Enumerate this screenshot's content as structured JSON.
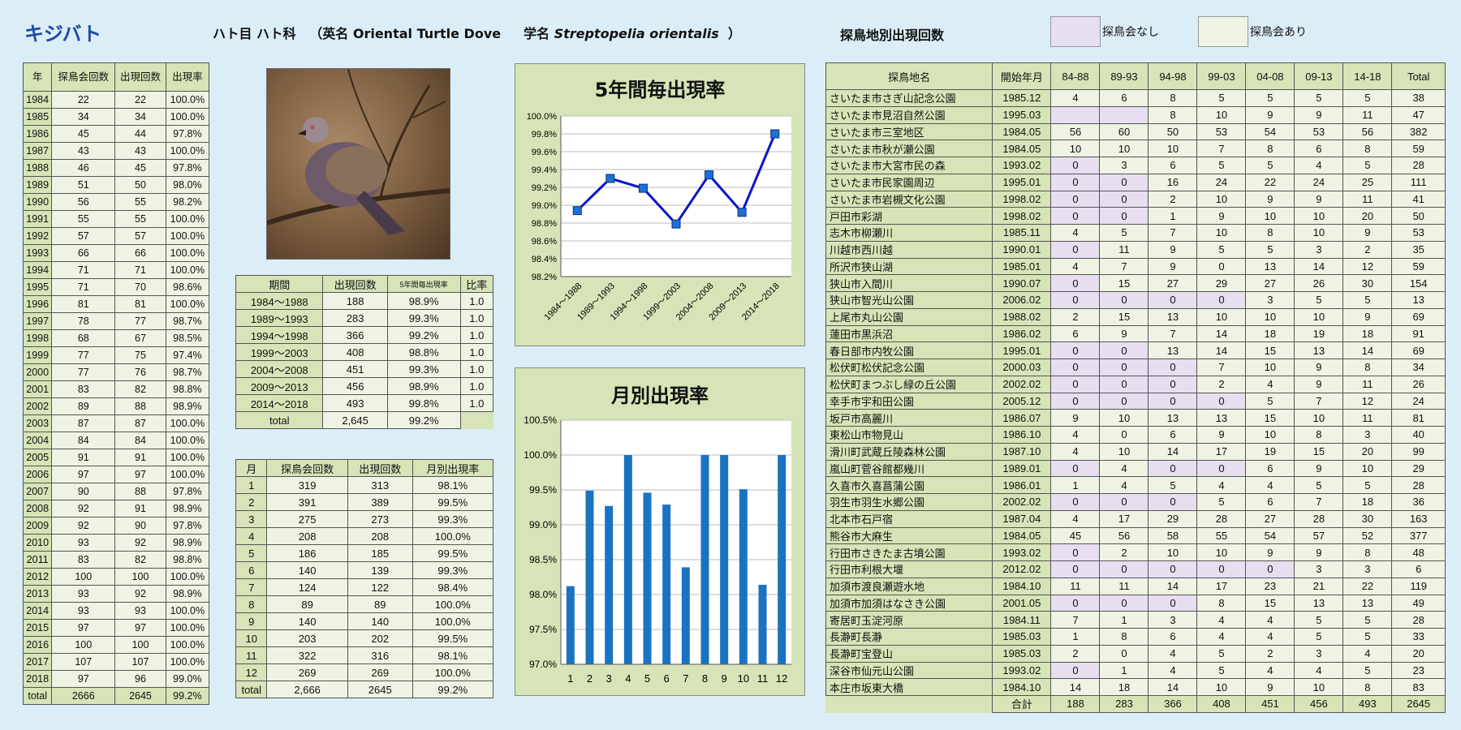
{
  "header": {
    "name_jp": "キジバト",
    "order_family": "ハト目 ハト科",
    "en_prefix": "（英名",
    "en_name": "Oriental Turtle Dove",
    "sci_prefix": "学名",
    "sci_name": "Streptopelia orientalis",
    "close": "）",
    "loc_title": "探鳥地別出現回数",
    "legend_none": "探鳥会なし",
    "legend_exist": "探鳥会あり"
  },
  "colors": {
    "bg": "#dbeef7",
    "header_cell": "#d7e4b7",
    "data_cell": "#eef3e3",
    "no_event_cell": "#e7def0",
    "title_blue": "#1f4aa8",
    "line_color": "#0a14c8",
    "bar_color": "#1a73c1"
  },
  "year_table": {
    "headers": [
      "年",
      "探鳥会回数",
      "出現回数",
      "出現率"
    ],
    "rows": [
      [
        "1984",
        "22",
        "22",
        "100.0%"
      ],
      [
        "1985",
        "34",
        "34",
        "100.0%"
      ],
      [
        "1986",
        "45",
        "44",
        "97.8%"
      ],
      [
        "1987",
        "43",
        "43",
        "100.0%"
      ],
      [
        "1988",
        "46",
        "45",
        "97.8%"
      ],
      [
        "1989",
        "51",
        "50",
        "98.0%"
      ],
      [
        "1990",
        "56",
        "55",
        "98.2%"
      ],
      [
        "1991",
        "55",
        "55",
        "100.0%"
      ],
      [
        "1992",
        "57",
        "57",
        "100.0%"
      ],
      [
        "1993",
        "66",
        "66",
        "100.0%"
      ],
      [
        "1994",
        "71",
        "71",
        "100.0%"
      ],
      [
        "1995",
        "71",
        "70",
        "98.6%"
      ],
      [
        "1996",
        "81",
        "81",
        "100.0%"
      ],
      [
        "1997",
        "78",
        "77",
        "98.7%"
      ],
      [
        "1998",
        "68",
        "67",
        "98.5%"
      ],
      [
        "1999",
        "77",
        "75",
        "97.4%"
      ],
      [
        "2000",
        "77",
        "76",
        "98.7%"
      ],
      [
        "2001",
        "83",
        "82",
        "98.8%"
      ],
      [
        "2002",
        "89",
        "88",
        "98.9%"
      ],
      [
        "2003",
        "87",
        "87",
        "100.0%"
      ],
      [
        "2004",
        "84",
        "84",
        "100.0%"
      ],
      [
        "2005",
        "91",
        "91",
        "100.0%"
      ],
      [
        "2006",
        "97",
        "97",
        "100.0%"
      ],
      [
        "2007",
        "90",
        "88",
        "97.8%"
      ],
      [
        "2008",
        "92",
        "91",
        "98.9%"
      ],
      [
        "2009",
        "92",
        "90",
        "97.8%"
      ],
      [
        "2010",
        "93",
        "92",
        "98.9%"
      ],
      [
        "2011",
        "83",
        "82",
        "98.8%"
      ],
      [
        "2012",
        "100",
        "100",
        "100.0%"
      ],
      [
        "2013",
        "93",
        "92",
        "98.9%"
      ],
      [
        "2014",
        "93",
        "93",
        "100.0%"
      ],
      [
        "2015",
        "97",
        "97",
        "100.0%"
      ],
      [
        "2016",
        "100",
        "100",
        "100.0%"
      ],
      [
        "2017",
        "107",
        "107",
        "100.0%"
      ],
      [
        "2018",
        "97",
        "96",
        "99.0%"
      ]
    ],
    "total": [
      "total",
      "2666",
      "2645",
      "99.2%"
    ]
  },
  "period_table": {
    "headers": [
      "期間",
      "出現回数",
      "5年間毎出現率",
      "比率"
    ],
    "rows": [
      [
        "1984～1988",
        "188",
        "98.9%",
        "1.0"
      ],
      [
        "1989～1993",
        "283",
        "99.3%",
        "1.0"
      ],
      [
        "1994～1998",
        "366",
        "99.2%",
        "1.0"
      ],
      [
        "1999～2003",
        "408",
        "98.8%",
        "1.0"
      ],
      [
        "2004～2008",
        "451",
        "99.3%",
        "1.0"
      ],
      [
        "2009～2013",
        "456",
        "98.9%",
        "1.0"
      ],
      [
        "2014～2018",
        "493",
        "99.8%",
        "1.0"
      ]
    ],
    "total": [
      "total",
      "2,645",
      "99.2%"
    ]
  },
  "month_table": {
    "headers": [
      "月",
      "探鳥会回数",
      "出現回数",
      "月別出現率"
    ],
    "rows": [
      [
        "1",
        "319",
        "313",
        "98.1%"
      ],
      [
        "2",
        "391",
        "389",
        "99.5%"
      ],
      [
        "3",
        "275",
        "273",
        "99.3%"
      ],
      [
        "4",
        "208",
        "208",
        "100.0%"
      ],
      [
        "5",
        "186",
        "185",
        "99.5%"
      ],
      [
        "6",
        "140",
        "139",
        "99.3%"
      ],
      [
        "7",
        "124",
        "122",
        "98.4%"
      ],
      [
        "8",
        "89",
        "89",
        "100.0%"
      ],
      [
        "9",
        "140",
        "140",
        "100.0%"
      ],
      [
        "10",
        "203",
        "202",
        "99.5%"
      ],
      [
        "11",
        "322",
        "316",
        "98.1%"
      ],
      [
        "12",
        "269",
        "269",
        "100.0%"
      ]
    ],
    "total": [
      "total",
      "2,666",
      "2645",
      "99.2%"
    ]
  },
  "loc_table": {
    "headers": [
      "探鳥地名",
      "開始年月",
      "84-88",
      "89-93",
      "94-98",
      "99-03",
      "04-08",
      "09-13",
      "14-18",
      "Total"
    ],
    "rows": [
      {
        "name": "さいたま市さぎ山記念公園",
        "start": "1985.12",
        "vals": [
          "4",
          "6",
          "8",
          "5",
          "5",
          "5",
          "5"
        ],
        "na": [],
        "total": "38"
      },
      {
        "name": "さいたま市見沼自然公園",
        "start": "1995.03",
        "vals": [
          "",
          "",
          "8",
          "10",
          "9",
          "9",
          "11"
        ],
        "na": [
          0,
          1
        ],
        "total": "47"
      },
      {
        "name": "さいたま市三室地区",
        "start": "1984.05",
        "vals": [
          "56",
          "60",
          "50",
          "53",
          "54",
          "53",
          "56"
        ],
        "na": [],
        "total": "382"
      },
      {
        "name": "さいたま市秋が瀬公園",
        "start": "1984.05",
        "vals": [
          "10",
          "10",
          "10",
          "7",
          "8",
          "6",
          "8"
        ],
        "na": [],
        "total": "59"
      },
      {
        "name": "さいたま市大宮市民の森",
        "start": "1993.02",
        "vals": [
          "0",
          "3",
          "6",
          "5",
          "5",
          "4",
          "5"
        ],
        "na": [
          0
        ],
        "total": "28"
      },
      {
        "name": "さいたま市民家園周辺",
        "start": "1995.01",
        "vals": [
          "0",
          "0",
          "16",
          "24",
          "22",
          "24",
          "25"
        ],
        "na": [
          0,
          1
        ],
        "total": "111"
      },
      {
        "name": "さいたま市岩槻文化公園",
        "start": "1998.02",
        "vals": [
          "0",
          "0",
          "2",
          "10",
          "9",
          "9",
          "11"
        ],
        "na": [
          0,
          1
        ],
        "total": "41"
      },
      {
        "name": "戸田市彩湖",
        "start": "1998.02",
        "vals": [
          "0",
          "0",
          "1",
          "9",
          "10",
          "10",
          "20"
        ],
        "na": [
          0,
          1
        ],
        "total": "50"
      },
      {
        "name": "志木市柳瀬川",
        "start": "1985.11",
        "vals": [
          "4",
          "5",
          "7",
          "10",
          "8",
          "10",
          "9"
        ],
        "na": [],
        "total": "53"
      },
      {
        "name": "川越市西川越",
        "start": "1990.01",
        "vals": [
          "0",
          "11",
          "9",
          "5",
          "5",
          "3",
          "2"
        ],
        "na": [
          0
        ],
        "total": "35"
      },
      {
        "name": "所沢市狭山湖",
        "start": "1985.01",
        "vals": [
          "4",
          "7",
          "9",
          "0",
          "13",
          "14",
          "12"
        ],
        "na": [],
        "total": "59"
      },
      {
        "name": "狭山市入間川",
        "start": "1990.07",
        "vals": [
          "0",
          "15",
          "27",
          "29",
          "27",
          "26",
          "30"
        ],
        "na": [
          0
        ],
        "total": "154"
      },
      {
        "name": "狭山市智光山公園",
        "start": "2006.02",
        "vals": [
          "0",
          "0",
          "0",
          "0",
          "3",
          "5",
          "5"
        ],
        "na": [
          0,
          1,
          2,
          3
        ],
        "total": "13"
      },
      {
        "name": "上尾市丸山公園",
        "start": "1988.02",
        "vals": [
          "2",
          "15",
          "13",
          "10",
          "10",
          "10",
          "9"
        ],
        "na": [],
        "total": "69"
      },
      {
        "name": "蓮田市黒浜沼",
        "start": "1986.02",
        "vals": [
          "6",
          "9",
          "7",
          "14",
          "18",
          "19",
          "18"
        ],
        "na": [],
        "total": "91"
      },
      {
        "name": "春日部市内牧公園",
        "start": "1995.01",
        "vals": [
          "0",
          "0",
          "13",
          "14",
          "15",
          "13",
          "14"
        ],
        "na": [
          0,
          1
        ],
        "total": "69"
      },
      {
        "name": "松伏町松伏記念公園",
        "start": "2000.03",
        "vals": [
          "0",
          "0",
          "0",
          "7",
          "10",
          "9",
          "8"
        ],
        "na": [
          0,
          1,
          2
        ],
        "total": "34"
      },
      {
        "name": "松伏町まつぶし緑の丘公園",
        "start": "2002.02",
        "vals": [
          "0",
          "0",
          "0",
          "2",
          "4",
          "9",
          "11"
        ],
        "na": [
          0,
          1,
          2
        ],
        "total": "26"
      },
      {
        "name": "幸手市宇和田公園",
        "start": "2005.12",
        "vals": [
          "0",
          "0",
          "0",
          "0",
          "5",
          "7",
          "12"
        ],
        "na": [
          0,
          1,
          2,
          3
        ],
        "total": "24"
      },
      {
        "name": "坂戸市高麗川",
        "start": "1986.07",
        "vals": [
          "9",
          "10",
          "13",
          "13",
          "15",
          "10",
          "11"
        ],
        "na": [],
        "total": "81"
      },
      {
        "name": "東松山市物見山",
        "start": "1986.10",
        "vals": [
          "4",
          "0",
          "6",
          "9",
          "10",
          "8",
          "3"
        ],
        "na": [],
        "total": "40"
      },
      {
        "name": "滑川町武蔵丘陵森林公園",
        "start": "1987.10",
        "vals": [
          "4",
          "10",
          "14",
          "17",
          "19",
          "15",
          "20"
        ],
        "na": [],
        "total": "99"
      },
      {
        "name": "嵐山町菅谷館都幾川",
        "start": "1989.01",
        "vals": [
          "0",
          "4",
          "0",
          "0",
          "6",
          "9",
          "10"
        ],
        "na": [
          0,
          2,
          3
        ],
        "total": "29"
      },
      {
        "name": "久喜市久喜菖蒲公園",
        "start": "1986.01",
        "vals": [
          "1",
          "4",
          "5",
          "4",
          "4",
          "5",
          "5"
        ],
        "na": [],
        "total": "28"
      },
      {
        "name": "羽生市羽生水郷公園",
        "start": "2002.02",
        "vals": [
          "0",
          "0",
          "0",
          "5",
          "6",
          "7",
          "18"
        ],
        "na": [
          0,
          1,
          2
        ],
        "total": "36"
      },
      {
        "name": "北本市石戸宿",
        "start": "1987.04",
        "vals": [
          "4",
          "17",
          "29",
          "28",
          "27",
          "28",
          "30"
        ],
        "na": [],
        "total": "163"
      },
      {
        "name": "熊谷市大麻生",
        "start": "1984.05",
        "vals": [
          "45",
          "56",
          "58",
          "55",
          "54",
          "57",
          "52"
        ],
        "na": [],
        "total": "377"
      },
      {
        "name": "行田市さきたま古墳公園",
        "start": "1993.02",
        "vals": [
          "0",
          "2",
          "10",
          "10",
          "9",
          "9",
          "8"
        ],
        "na": [
          0
        ],
        "total": "48"
      },
      {
        "name": "行田市利根大堰",
        "start": "2012.02",
        "vals": [
          "0",
          "0",
          "0",
          "0",
          "0",
          "3",
          "3"
        ],
        "na": [
          0,
          1,
          2,
          3,
          4
        ],
        "total": "6"
      },
      {
        "name": "加須市渡良瀬遊水地",
        "start": "1984.10",
        "vals": [
          "11",
          "11",
          "14",
          "17",
          "23",
          "21",
          "22"
        ],
        "na": [],
        "total": "119"
      },
      {
        "name": "加須市加須はなさき公園",
        "start": "2001.05",
        "vals": [
          "0",
          "0",
          "0",
          "8",
          "15",
          "13",
          "13"
        ],
        "na": [
          0,
          1,
          2
        ],
        "total": "49"
      },
      {
        "name": "寄居町玉淀河原",
        "start": "1984.11",
        "vals": [
          "7",
          "1",
          "3",
          "4",
          "4",
          "5",
          "5"
        ],
        "na": [],
        "total": "28"
      },
      {
        "name": "長瀞町長瀞",
        "start": "1985.03",
        "vals": [
          "1",
          "8",
          "6",
          "4",
          "4",
          "5",
          "5"
        ],
        "na": [],
        "total": "33"
      },
      {
        "name": "長瀞町宝登山",
        "start": "1985.03",
        "vals": [
          "2",
          "0",
          "4",
          "5",
          "2",
          "3",
          "4"
        ],
        "na": [],
        "total": "20"
      },
      {
        "name": "深谷市仙元山公園",
        "start": "1993.02",
        "vals": [
          "0",
          "1",
          "4",
          "5",
          "4",
          "4",
          "5"
        ],
        "na": [
          0
        ],
        "total": "23"
      },
      {
        "name": "本庄市坂東大橋",
        "start": "1984.10",
        "vals": [
          "14",
          "18",
          "14",
          "10",
          "9",
          "10",
          "8"
        ],
        "na": [],
        "total": "83"
      }
    ],
    "sum_label": "合計",
    "sums": [
      "188",
      "283",
      "366",
      "408",
      "451",
      "456",
      "493",
      "2645"
    ]
  },
  "chart_data": [
    {
      "type": "line",
      "title": "5年間毎出現率",
      "categories": [
        "1984～1988",
        "1989～1993",
        "1994～1998",
        "1999～2003",
        "2004～2008",
        "2009～2013",
        "2014～2018"
      ],
      "values": [
        98.94,
        99.3,
        99.19,
        98.79,
        99.34,
        98.92,
        99.8
      ],
      "ylim": [
        98.2,
        100.0
      ],
      "yticks": [
        "98.2%",
        "98.4%",
        "98.6%",
        "98.8%",
        "99.0%",
        "99.2%",
        "99.4%",
        "99.6%",
        "99.8%",
        "100.0%"
      ],
      "grid": true
    },
    {
      "type": "bar",
      "title": "月別出現率",
      "categories": [
        "1",
        "2",
        "3",
        "4",
        "5",
        "6",
        "7",
        "8",
        "9",
        "10",
        "11",
        "12"
      ],
      "values": [
        98.12,
        99.49,
        99.27,
        100.0,
        99.46,
        99.29,
        98.39,
        100.0,
        100.0,
        99.51,
        98.14,
        100.0
      ],
      "ylim": [
        97.0,
        100.5
      ],
      "yticks": [
        "97.0%",
        "97.5%",
        "98.0%",
        "98.5%",
        "99.0%",
        "99.5%",
        "100.0%",
        "100.5%"
      ],
      "grid": true
    }
  ]
}
